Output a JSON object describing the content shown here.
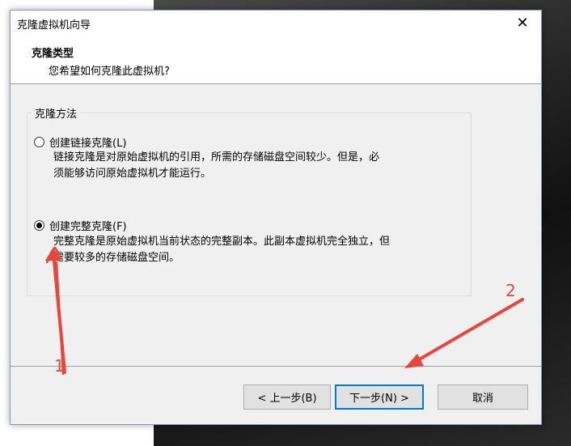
{
  "window": {
    "title": "克隆虚拟机向导",
    "close_glyph": "✕"
  },
  "header": {
    "title": "克隆类型",
    "subtitle": "您希望如何克隆此虚拟机?"
  },
  "clone_method": {
    "group_label": "克隆方法",
    "options": [
      {
        "label": "创建链接克隆(L)",
        "description_line1": "链接克隆是对原始虚拟机的引用，所需的存储磁盘空间较少。但是，必",
        "description_line2": "须能够访问原始虚拟机才能运行。",
        "checked": false
      },
      {
        "label": "创建完整克隆(F)",
        "description_line1": "完整克隆是原始虚拟机当前状态的完整副本。此副本虚拟机完全独立，但",
        "description_line2": "需要较多的存储磁盘空间。",
        "checked": true
      }
    ]
  },
  "buttons": {
    "back": "< 上一步(B)",
    "next": "下一步(N) >",
    "cancel": "取消"
  },
  "annotations": {
    "color": "#e8453c",
    "marker_1": "1",
    "marker_2": "2"
  }
}
